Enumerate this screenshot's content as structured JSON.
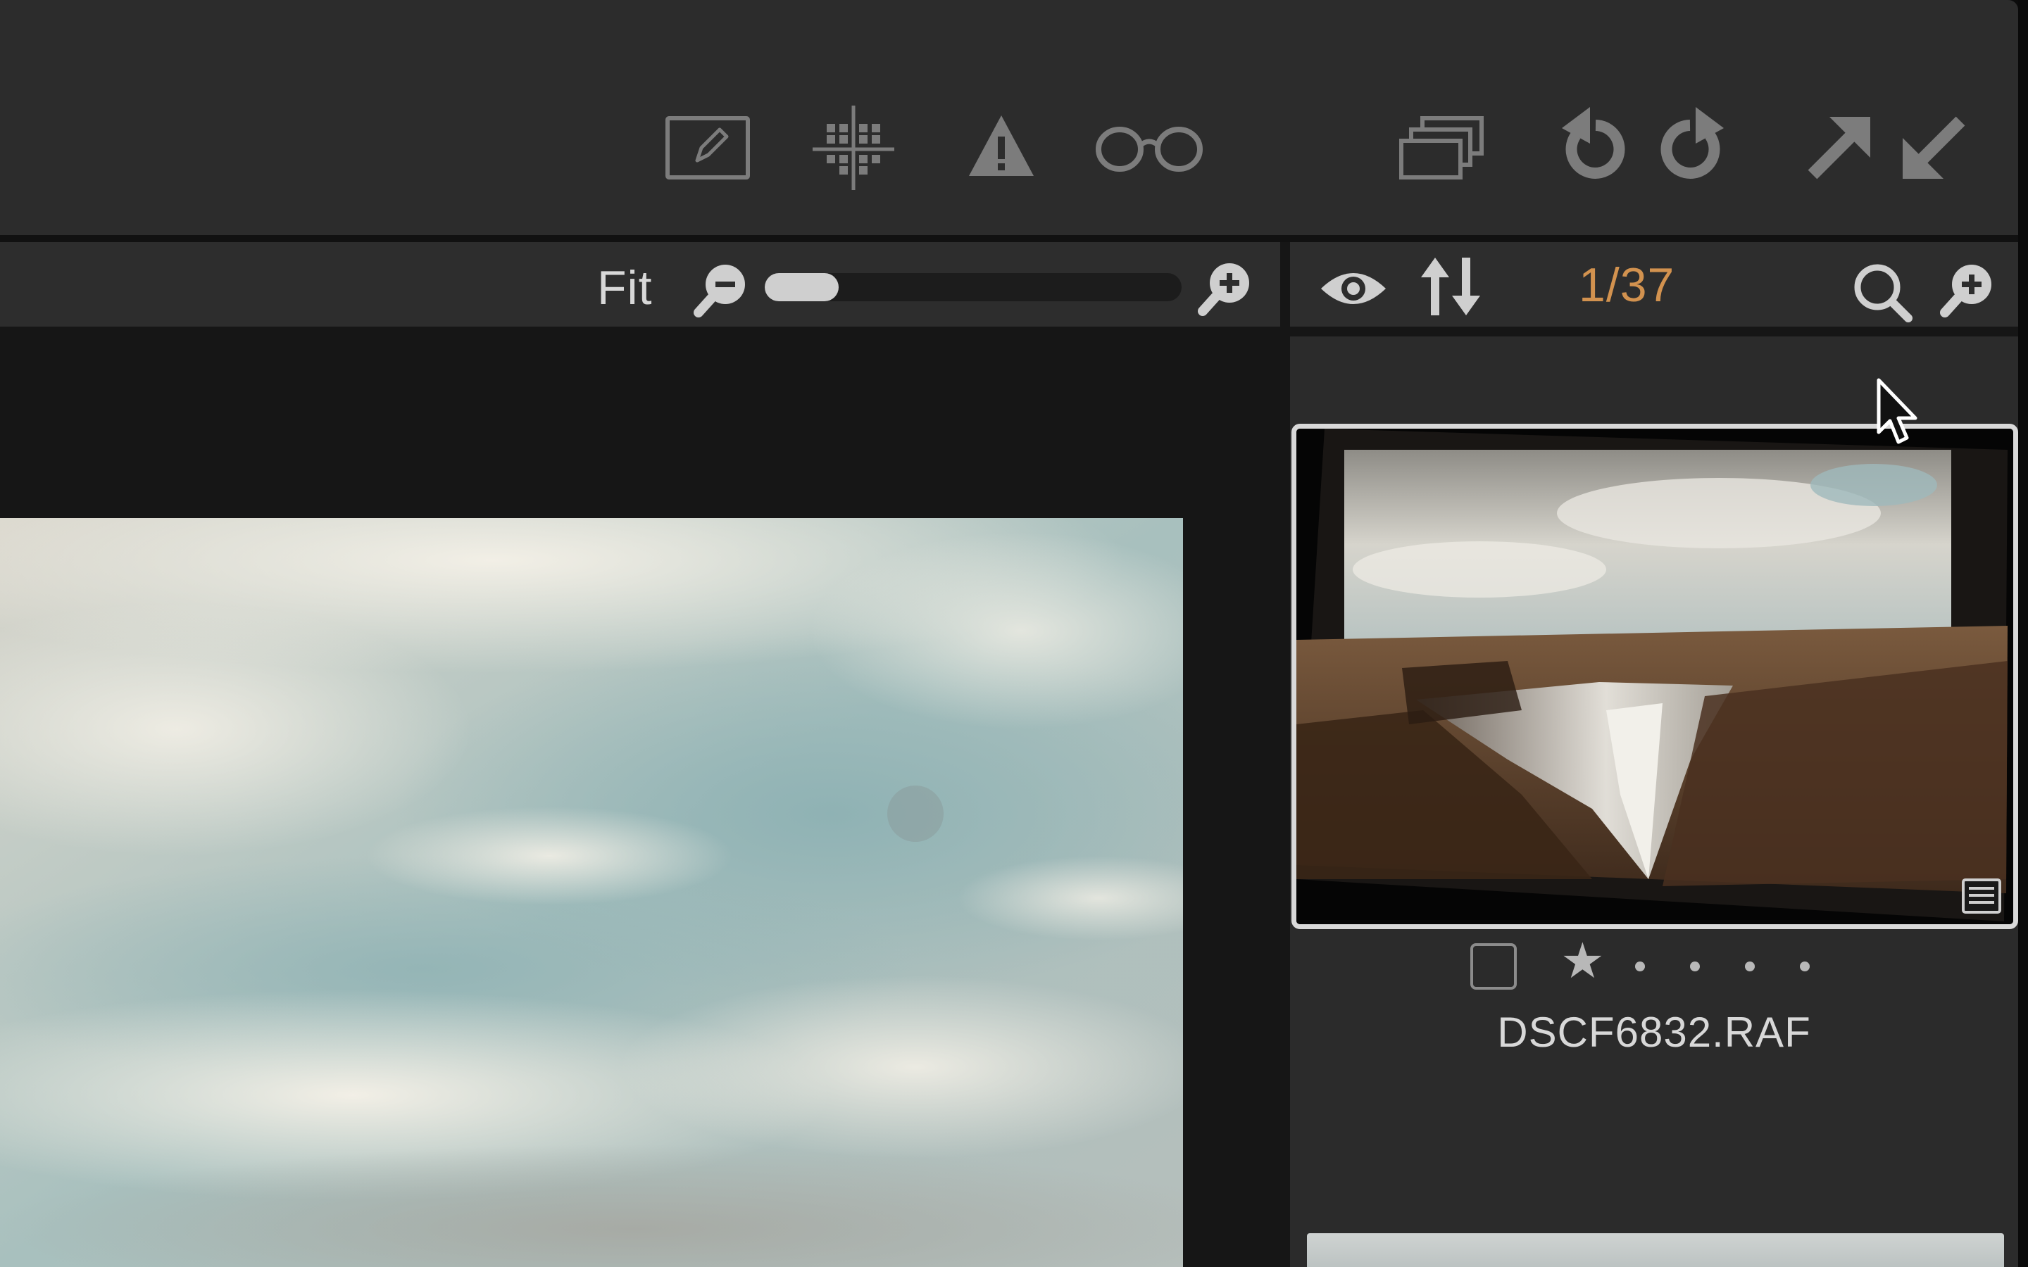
{
  "toolbar": {
    "icons": [
      "edit-icon",
      "grid-overlay-icon",
      "exposure-warning-icon",
      "loupe-icon",
      "stack-icon",
      "rotate-left-icon",
      "rotate-right-icon",
      "expand-icon",
      "collapse-icon"
    ]
  },
  "viewer": {
    "zoom_label": "Fit",
    "zoom_level": 0.05
  },
  "browser": {
    "counter": "1/37",
    "selected_item": {
      "filename": "DSCF6832.RAF",
      "rating_stars": 1,
      "rating_max": 5
    }
  },
  "colors": {
    "accent_counter": "#d2924f",
    "toolbar_bg": "#2c2c2c",
    "icon_gray": "#7c7c7c"
  }
}
